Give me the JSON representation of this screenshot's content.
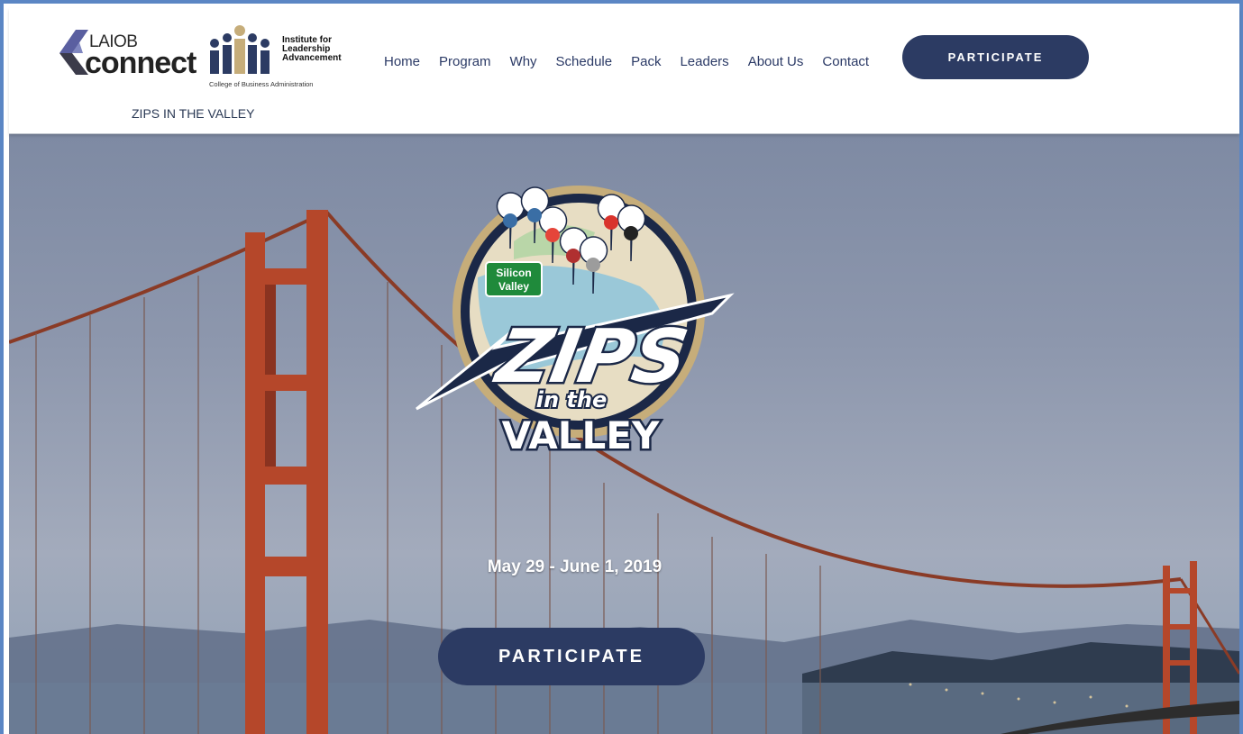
{
  "header": {
    "logo_laiob_top": "LAIOB",
    "logo_laiob_main": "connect",
    "logo_ila_line1": "Institute for",
    "logo_ila_line2": "Leadership",
    "logo_ila_line3": "Advancement",
    "logo_ila_sub": "College of Business Administration",
    "site_name": "ZIPS IN THE VALLEY",
    "nav": [
      "Home",
      "Program",
      "Why",
      "Schedule",
      "Pack",
      "Leaders",
      "About Us",
      "Contact"
    ],
    "participate_label": "PARTICIPATE"
  },
  "hero": {
    "badge_text_silicon": "Silicon",
    "badge_text_valley_sign": "Valley",
    "badge_text_zips": "ZIPS",
    "badge_text_in_the": "in the",
    "badge_text_valley": "VALLEY",
    "date": "May 29 - June 1, 2019",
    "participate_label": "PARTICIPATE"
  },
  "colors": {
    "navy": "#2c3b63",
    "frame": "#5b86c4",
    "bridge": "#b5472a"
  }
}
